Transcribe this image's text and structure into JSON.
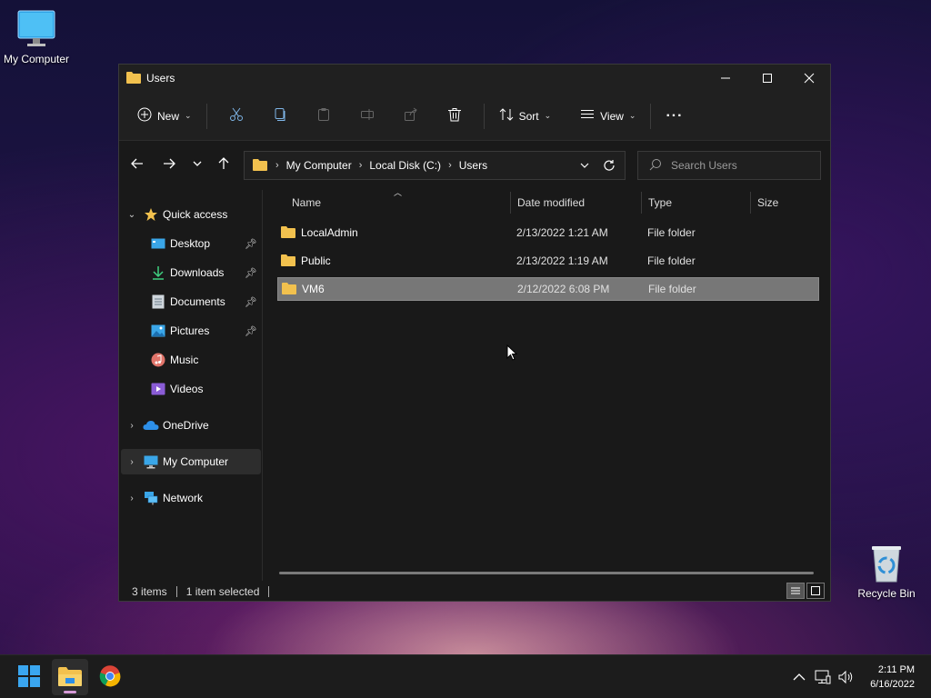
{
  "desktop": {
    "my_computer_label": "My Computer",
    "recycle_bin_label": "Recycle Bin"
  },
  "window": {
    "title": "Users"
  },
  "toolbar": {
    "new_label": "New",
    "sort_label": "Sort",
    "view_label": "View",
    "more_label": "···"
  },
  "address": {
    "crumbs": [
      "My Computer",
      "Local Disk (C:)",
      "Users"
    ],
    "search_placeholder": "Search Users"
  },
  "sidebar": {
    "quick_access": "Quick access",
    "items": [
      "Desktop",
      "Downloads",
      "Documents",
      "Pictures",
      "Music",
      "Videos"
    ],
    "onedrive": "OneDrive",
    "my_computer": "My Computer",
    "network": "Network"
  },
  "columns": {
    "name": "Name",
    "date": "Date modified",
    "type": "Type",
    "size": "Size"
  },
  "files": [
    {
      "name": "LocalAdmin",
      "date": "2/13/2022 1:21 AM",
      "type": "File folder"
    },
    {
      "name": "Public",
      "date": "2/13/2022 1:19 AM",
      "type": "File folder"
    },
    {
      "name": "VM6",
      "date": "2/12/2022 6:08 PM",
      "type": "File folder"
    }
  ],
  "status": {
    "count": "3 items",
    "selected": "1 item selected"
  },
  "clock": {
    "time": "2:11 PM",
    "date": "6/16/2022"
  },
  "colors": {
    "accent": "#0078d4",
    "folder": "#f2c14e",
    "selection": "#777777"
  }
}
